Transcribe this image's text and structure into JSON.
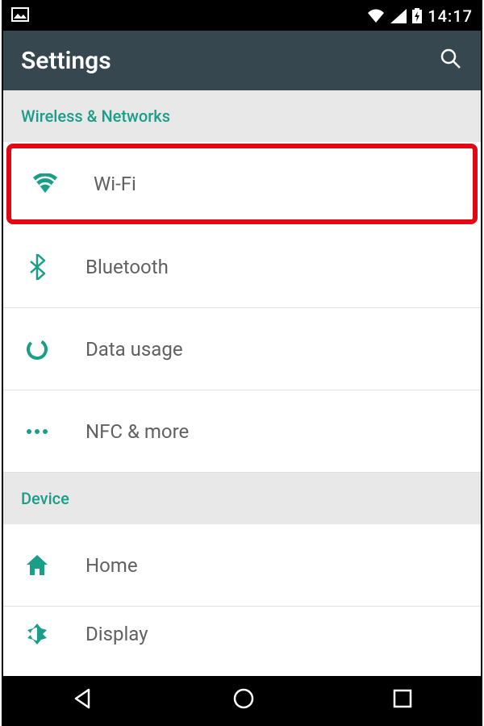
{
  "statusBar": {
    "time": "14:17"
  },
  "appBar": {
    "title": "Settings"
  },
  "sections": {
    "wireless": {
      "header": "Wireless & Networks",
      "items": [
        {
          "label": "Wi-Fi"
        },
        {
          "label": "Bluetooth"
        },
        {
          "label": "Data usage"
        },
        {
          "label": "NFC & more"
        }
      ]
    },
    "device": {
      "header": "Device",
      "items": [
        {
          "label": "Home"
        },
        {
          "label": "Display"
        }
      ]
    }
  },
  "colors": {
    "accent": "#1a9e8a",
    "highlight": "#e30613"
  }
}
